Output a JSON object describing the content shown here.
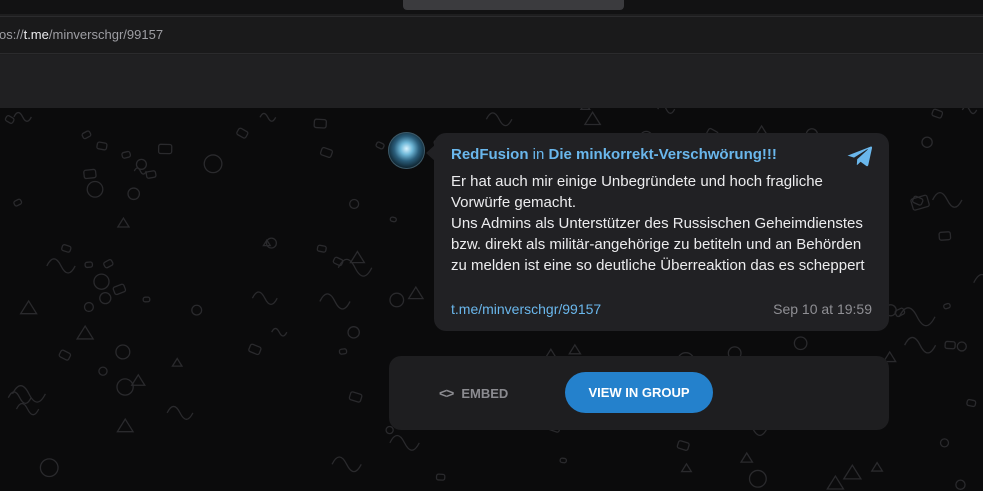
{
  "browser": {
    "url_prefix": "os://",
    "url_host": "t.me",
    "url_path": "/minverschgr/99157"
  },
  "post": {
    "author": "RedFusion",
    "in_word": "in",
    "group": "Die minkorrekt-Verschwörung!!!",
    "body": "Er hat auch mir einige Unbegründete und hoch fragliche Vorwürfe gemacht.\nUns Admins als Unterstützer des Russischen Geheimdienstes bzw. direkt als militär-angehörige zu betiteln und an Behörden zu melden ist eine so deutliche Überreaktion das es scheppert",
    "link": "t.me/minverschgr/99157",
    "date": "Sep 10 at 19:59"
  },
  "actions": {
    "embed_icon": "<>",
    "embed_label": "EMBED",
    "view_label": "VIEW IN GROUP"
  },
  "colors": {
    "accent": "#2481cc",
    "link": "#6ab7ec",
    "bubble": "#212124",
    "background": "#0b0b0c"
  },
  "icons": {
    "telegram": "telegram-plane-icon",
    "embed": "code-brackets-icon"
  }
}
